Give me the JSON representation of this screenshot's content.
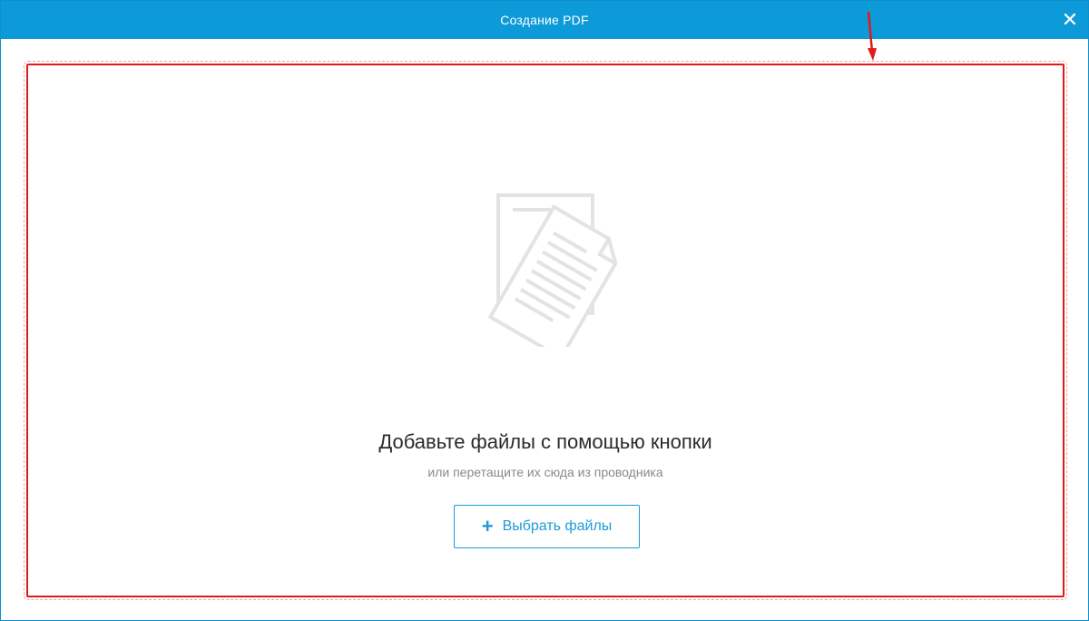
{
  "window": {
    "title": "Создание PDF",
    "close_glyph": "✕"
  },
  "drop_area": {
    "heading": "Добавьте файлы с помощью кнопки",
    "subheading": "или перетащите их сюда из проводника",
    "icon": "documents-icon"
  },
  "choose_button": {
    "plus_glyph": "+",
    "label": "Выбрать файлы"
  },
  "colors": {
    "titlebar": "#0d9ad9",
    "accent": "#1c9bd7",
    "highlight": "#e01919"
  }
}
